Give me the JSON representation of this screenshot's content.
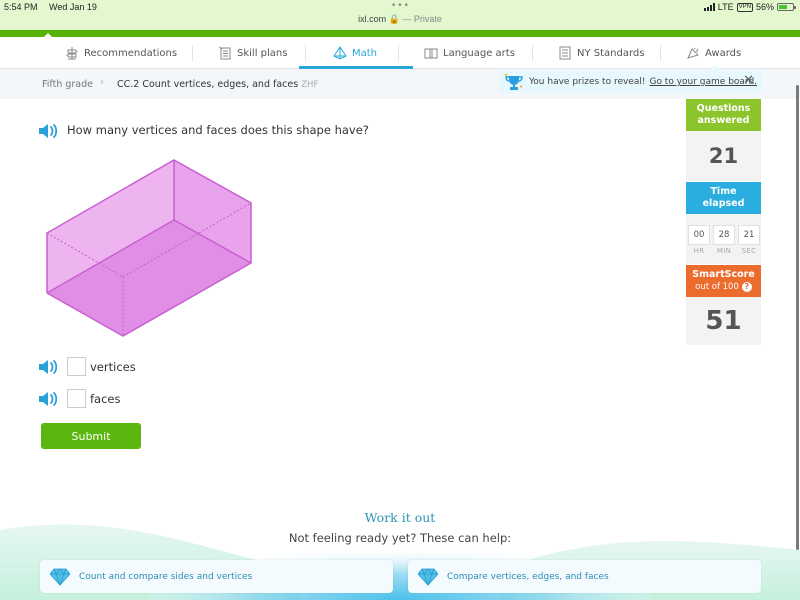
{
  "status_bar": {
    "time": "5:54 PM",
    "date": "Wed Jan 19",
    "url": "ixl.com",
    "private_label": "— Private",
    "network": "LTE",
    "vpn": "VPN",
    "battery": "56%"
  },
  "nav": {
    "items": [
      {
        "label": "Recommendations",
        "icon": "signpost-icon",
        "active": false
      },
      {
        "label": "Skill plans",
        "icon": "clipboard-icon",
        "active": false
      },
      {
        "label": "Math",
        "icon": "pyramid-icon",
        "active": true
      },
      {
        "label": "Language arts",
        "icon": "book-icon",
        "active": false
      },
      {
        "label": "NY Standards",
        "icon": "checklist-icon",
        "active": false
      },
      {
        "label": "Awards",
        "icon": "ribbon-icon",
        "active": false
      }
    ]
  },
  "breadcrumb": {
    "grade": "Fifth grade",
    "skill": "CC.2 Count vertices, edges, and faces",
    "code": "ZHF"
  },
  "prize_banner": {
    "text": "You have prizes to reveal!",
    "link": "Go to your game board.",
    "close": "✕"
  },
  "question": {
    "prompt": "How many vertices and faces does this shape have?",
    "shape": "rectangular prism",
    "answers": [
      {
        "label": "vertices",
        "value": ""
      },
      {
        "label": "faces",
        "value": ""
      }
    ],
    "submit_label": "Submit"
  },
  "sidebar": {
    "questions_answered_label_1": "Questions",
    "questions_answered_label_2": "answered",
    "questions_answered": "21",
    "time_elapsed_label_1": "Time",
    "time_elapsed_label_2": "elapsed",
    "time": {
      "hr": "00",
      "min": "28",
      "sec": "21"
    },
    "time_units": {
      "hr": "HR",
      "min": "MIN",
      "sec": "SEC"
    },
    "smartscore_label": "SmartScore",
    "smartscore_sub": "out of 100",
    "smartscore_help": "?",
    "smartscore": "51"
  },
  "work_it_out": {
    "title": "Work it out",
    "subtitle": "Not feeling ready yet? These can help:",
    "cards": [
      {
        "label": "Count and compare sides and vertices",
        "icon": "gem-icon"
      },
      {
        "label": "Compare vertices, edges, and faces",
        "icon": "gem-icon"
      }
    ]
  },
  "colors": {
    "brand_green": "#56b204",
    "accent_blue": "#2aa7d8",
    "questions_green": "#8bc42b",
    "time_blue": "#2aaee0",
    "smartscore_orange": "#ec6c2e",
    "shape_fill": "#e9a0ec",
    "shape_stroke": "#c95fd0"
  }
}
